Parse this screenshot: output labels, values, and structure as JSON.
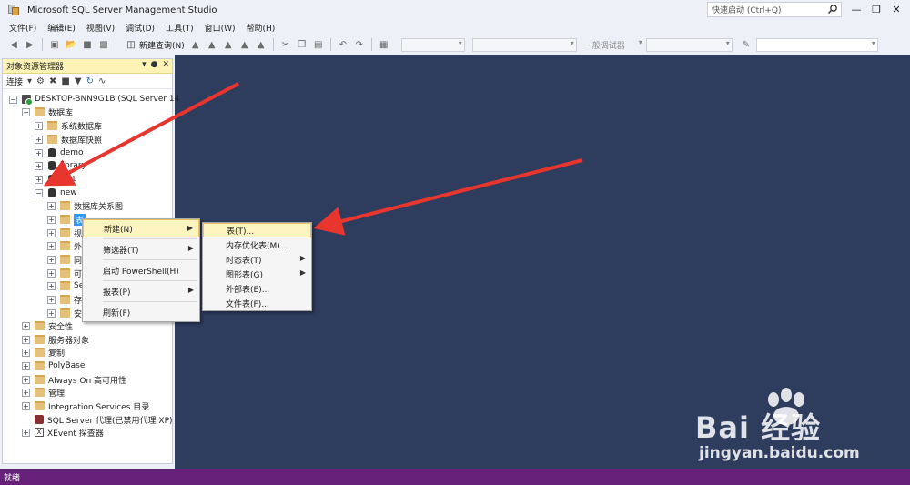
{
  "window": {
    "title": "Microsoft SQL Server Management Studio"
  },
  "quick_launch": {
    "placeholder": "快速启动 (Ctrl+Q)"
  },
  "menu": [
    "文件(F)",
    "编辑(E)",
    "视图(V)",
    "调试(D)",
    "工具(T)",
    "窗口(W)",
    "帮助(H)"
  ],
  "toolbar": {
    "new_query": "新建查询(N)",
    "debugger_dropdown": "一般调试器"
  },
  "object_explorer": {
    "title": "对象资源管理器",
    "toolbar_connect": "连接",
    "tree": {
      "server": "DESKTOP-BNN9G1B (SQL Server 14",
      "databases": "数据库",
      "system_databases": "系统数据库",
      "db_snapshots": "数据库快照",
      "demo": "demo",
      "library": "library",
      "test": "test",
      "new": "new",
      "db_diagrams": "数据库关系图",
      "tables": "表",
      "views_partial": "视",
      "external_partial": "外",
      "synonyms_partial": "同",
      "programmability_partial": "可",
      "sb_partial": "Se",
      "storage_partial": "存",
      "security_partial": "安全性",
      "security": "安全性",
      "server_objects": "服务器对象",
      "replication": "复制",
      "polybase": "PolyBase",
      "always_on": "Always On 高可用性",
      "management": "管理",
      "integration_services": "Integration Services 目录",
      "sql_agent": "SQL Server 代理(已禁用代理 XP)",
      "xevent": "XEvent 探查器"
    }
  },
  "context_menu": {
    "new": "新建(N)",
    "filter": "筛选器(T)",
    "powershell": "启动 PowerShell(H)",
    "reports": "报表(P)",
    "refresh": "刷新(F)"
  },
  "submenu_new": {
    "table": "表(T)...",
    "memory_optimized": "内存优化表(M)...",
    "temporal": "时态表(T)",
    "graph": "图形表(G)",
    "external": "外部表(E)...",
    "file_table": "文件表(F)..."
  },
  "status": {
    "text": "就绪"
  },
  "watermark": {
    "logo": "Bai 经验",
    "sub": "jingyan.baidu.com"
  },
  "colors": {
    "editor_bg": "#2e3c5e",
    "status_bg": "#68217a",
    "header_bg": "#fcf3b4",
    "arrow": "#e8352d"
  }
}
